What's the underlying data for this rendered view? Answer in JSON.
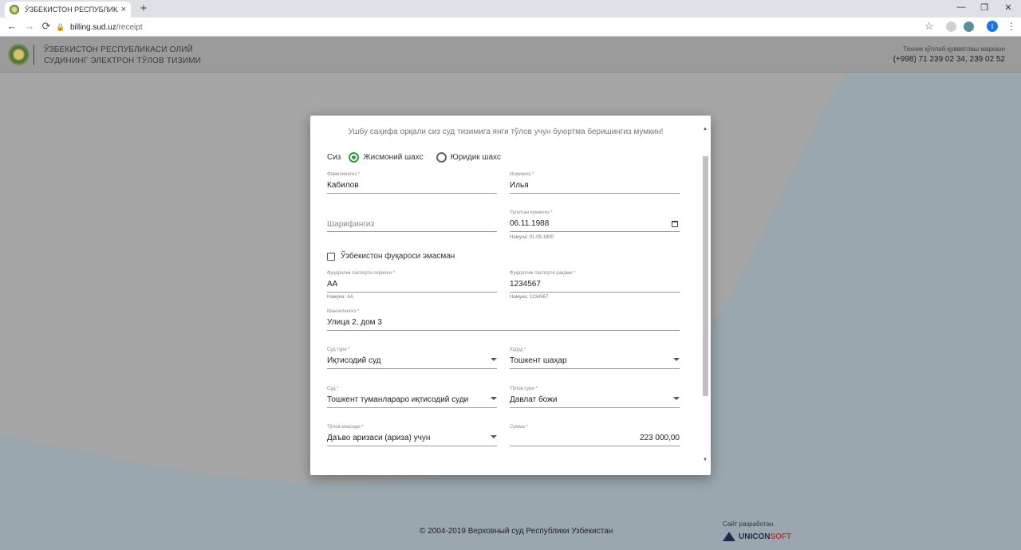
{
  "browser": {
    "tab_title": "ЎЗБЕКИСТОН РЕСПУБЛИКАСИ (",
    "tab_close": "×",
    "new_tab": "+",
    "url_host": "billing.sud.uz",
    "url_path": "/receipt",
    "profile_initial": "I"
  },
  "header": {
    "title_line1": "ЎЗБЕКИСТОН РЕСПУБЛИКАСИ ОЛИЙ",
    "title_line2": "СУДИНИНГ ЭЛЕКТРОН ТЎЛОВ ТИЗИМИ",
    "support_label": "Техник қўллаб-қувватлаш маркази",
    "support_phone": "(+998) 71 239 02 34, 239 02 52"
  },
  "form": {
    "intro": "Ушбу саҳифа орқали сиз суд тизимига янги тўлов учун буюртма беришингиз мумкин!",
    "party_prefix": "Сиз",
    "party_individual": "Жисмоний шахс",
    "party_legal": "Юридик шахс",
    "surname": {
      "label": "Фамилиянгиз *",
      "value": "Кабилов"
    },
    "name": {
      "label": "Исмингиз *",
      "value": "Илья"
    },
    "patronymic": {
      "placeholder": "Шарифингиз"
    },
    "birthdate": {
      "label": "Туғилган кунингиз *",
      "value": "06.11.1988",
      "hint": "Намуна: 01.09.1800"
    },
    "not_citizen_label": "Ўзбекистон фуқароси эмасман",
    "passport_series": {
      "label": "Фуқаролик паспорти серияси *",
      "value": "AA",
      "hint": "Намуна: AA"
    },
    "passport_number": {
      "label": "Фуқаролик паспорти рақами *",
      "value": "1234567",
      "hint": "Намуна: 1234567"
    },
    "address": {
      "label": "Манзилингиз *",
      "value": "Улица 2, дом 3"
    },
    "court_type": {
      "label": "Суд тури *",
      "value": "Иқтисодий суд"
    },
    "region": {
      "label": "Худуд *",
      "value": "Тошкент шаҳар"
    },
    "court": {
      "label": "Суд *",
      "value": "Тошкент туманлараро иқтисодий суди"
    },
    "payment_type": {
      "label": "Тўлов тури *",
      "value": "Давлат божи"
    },
    "payment_purpose": {
      "label": "Тўлов мақсади *",
      "value": "Даъво аризаси (ариза) учун"
    },
    "amount": {
      "label": "Сумма *",
      "value": "223 000,00"
    }
  },
  "footer": {
    "copyright": "© 2004-2019 Верховный суд Республики Узбекистан",
    "dev_label": "Сайт разработан",
    "dev_name_a": "UNICON",
    "dev_name_b": "SOFT"
  },
  "colors": {
    "accent_green": "#2e9e3f",
    "overlay": "#979ea2"
  }
}
